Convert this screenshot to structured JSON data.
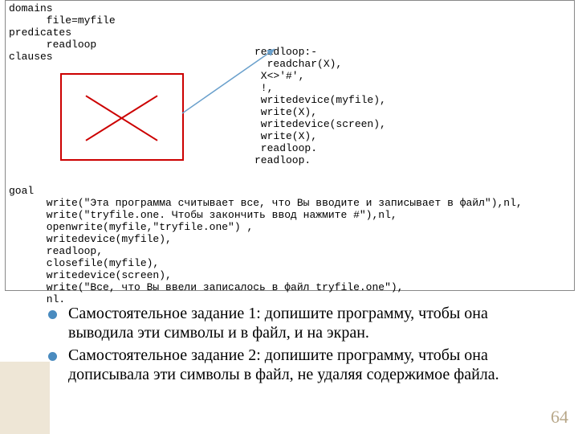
{
  "code": {
    "left": "domains\n      file=myfile\npredicates\n      readloop\nclauses",
    "right": "readloop:-\n  readchar(X),\n X<>'#',\n !,\n writedevice(myfile),\n write(X),\n writedevice(screen),\n write(X),\n readloop.\nreadloop.",
    "goal": "goal\n      write(\"Эта программа считывает все, что Вы вводите и записывает в файл\"),nl,\n      write(\"tryfile.one. Чтобы закончить ввод нажмите #\"),nl,\n      openwrite(myfile,\"tryfile.one\") ,\n      writedevice(myfile),\n      readloop,\n      closefile(myfile),\n      writedevice(screen),\n      write(\"Все, что Вы ввели записалось в файл tryfile.one\"),\n      nl."
  },
  "tasks": {
    "item1": "Самостоятельное задание 1: допишите программу, чтобы она выводила эти символы и в файл, и на экран.",
    "item2": "Самостоятельное задание 2: допишите программу, чтобы она дописывала эти символы  в файл, не удаляя содержимое файла."
  },
  "page": "64"
}
